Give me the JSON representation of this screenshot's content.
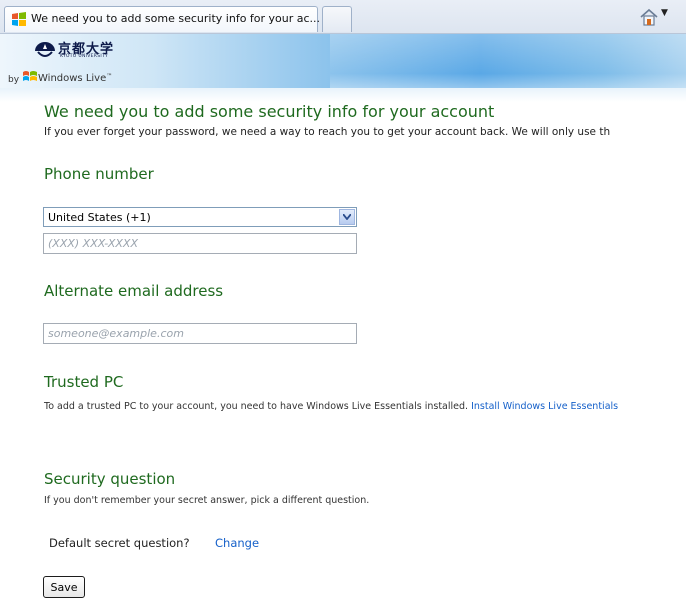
{
  "browser": {
    "active_tab_title": "We need you to add some security info for your ac..."
  },
  "header": {
    "logo_kanji": "京都大学",
    "logo_sub": "KYOTO UNIVERSITY",
    "by_label": "by",
    "windows_live": "Windows Live",
    "tm": "™"
  },
  "page": {
    "title": "We need you to add some security info for your account",
    "intro": "If you ever forget your password, we need a way to reach you to get your account back. We will only use th"
  },
  "phone": {
    "heading": "Phone number",
    "country_selected": "United States (+1)",
    "number_placeholder": "(XXX) XXX-XXXX",
    "number_value": ""
  },
  "email": {
    "heading": "Alternate email address",
    "placeholder": "someone@example.com",
    "value": ""
  },
  "trusted_pc": {
    "heading": "Trusted PC",
    "description": "To add a trusted PC to your account, you need to have Windows Live Essentials installed.",
    "link": "Install Windows Live Essentials"
  },
  "security_question": {
    "heading": "Security question",
    "description": "If you don't remember your secret answer, pick a different question.",
    "current_label": "Default secret question?",
    "change_link": "Change"
  },
  "actions": {
    "save_label": "Save"
  },
  "colors": {
    "heading_green": "#1f6a1f",
    "link_blue": "#1560c9",
    "banner_blue": "#5aa8e6"
  }
}
